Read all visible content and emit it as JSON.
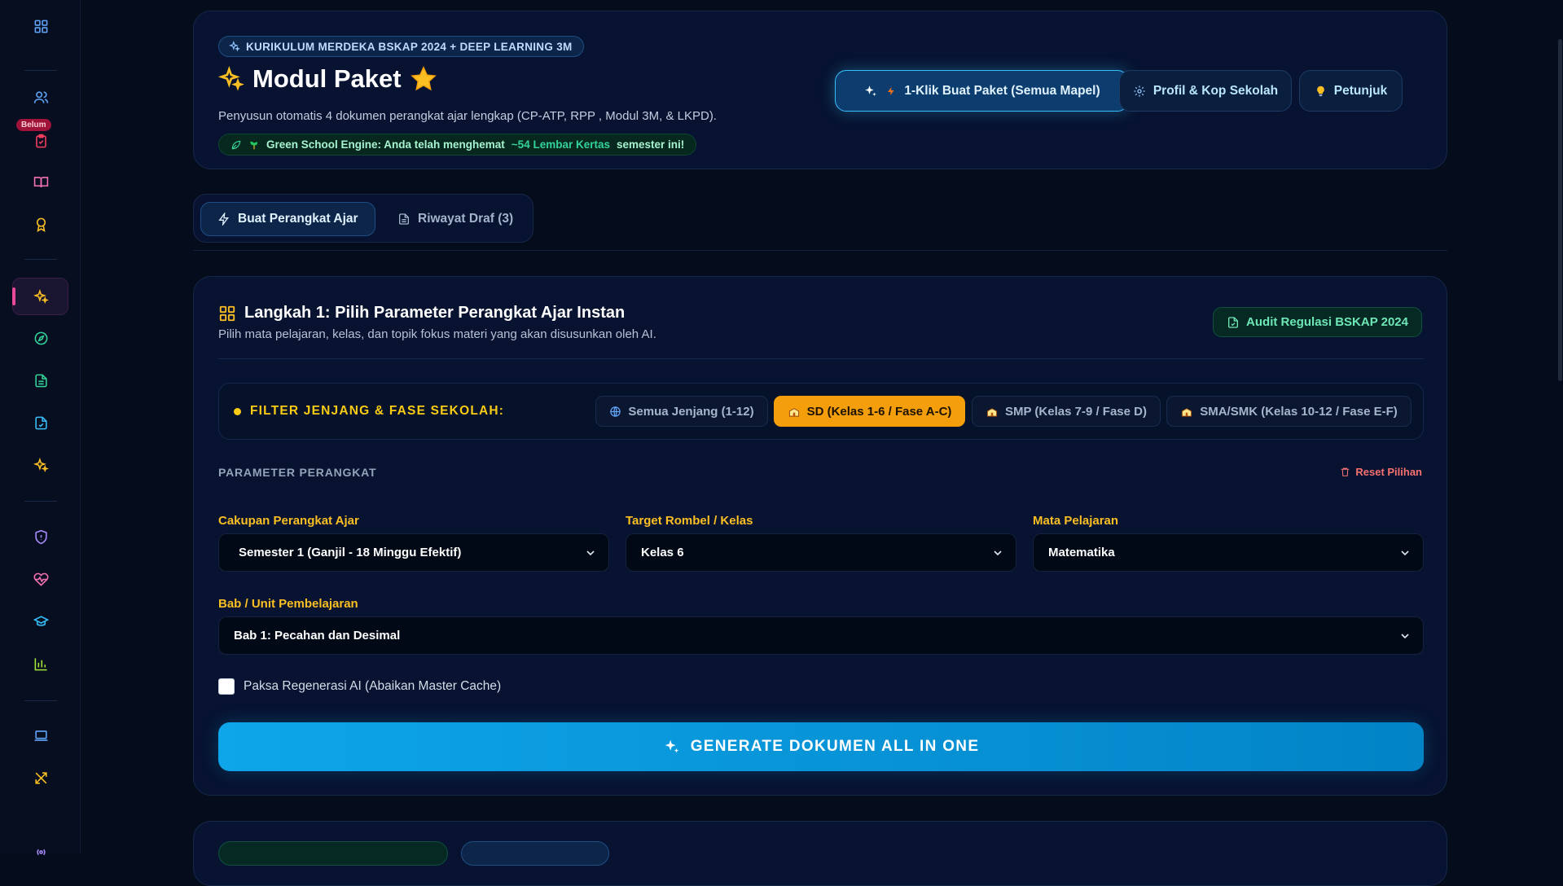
{
  "colors": {
    "background": "#050c1c",
    "card": "#071330",
    "accent_blue": "#38bdf8",
    "accent_amber": "#f59e0b",
    "accent_green": "#34d399",
    "accent_red": "#f87171",
    "label_amber": "#fbbf24"
  },
  "sidebar": {
    "items": [
      {
        "icon": "grid-icon"
      },
      {
        "icon": "users-icon"
      },
      {
        "icon": "clipboard-check-icon",
        "badge": "Belum"
      },
      {
        "icon": "book-open-icon"
      },
      {
        "icon": "award-icon"
      },
      {
        "icon": "sparkles-icon",
        "active": true
      },
      {
        "icon": "compass-icon"
      },
      {
        "icon": "file-text-icon"
      },
      {
        "icon": "file-check-icon"
      },
      {
        "icon": "sparkles-icon"
      },
      {
        "icon": "shield-icon"
      },
      {
        "icon": "heart-pulse-icon"
      },
      {
        "icon": "graduation-cap-icon"
      },
      {
        "icon": "bar-chart-icon"
      },
      {
        "icon": "laptop-icon"
      },
      {
        "icon": "tools-icon"
      },
      {
        "icon": "broadcast-icon"
      }
    ],
    "badge_label": "Belum"
  },
  "header": {
    "pill": "KURIKULUM MERDEKA BSKAP 2024 + DEEP LEARNING 3M",
    "title": "Modul Paket",
    "subtitle": "Penyusun otomatis 4 dokumen perangkat ajar lengkap (CP-ATP, RPP , Modul 3M, & LKPD).",
    "green_engine": {
      "prefix": "Green School Engine: Anda telah menghemat",
      "highlight": "~54 Lembar Kertas",
      "suffix": "semester ini!"
    },
    "buttons": {
      "primary": "1-Klik Buat Paket (Semua Mapel)",
      "profile": "Profil & Kop Sekolah",
      "guide": "Petunjuk"
    }
  },
  "tabs": [
    {
      "label": "Buat Perangkat Ajar",
      "active": true
    },
    {
      "label": "Riwayat Draf (3)",
      "active": false
    }
  ],
  "step": {
    "title": "Langkah 1: Pilih Parameter Perangkat Ajar Instan",
    "subtitle": "Pilih mata pelajaran, kelas, dan topik fokus materi yang akan disusunkan oleh AI.",
    "audit_button": "Audit Regulasi BSKAP 2024",
    "filter": {
      "label": "FILTER JENJANG & FASE SEKOLAH:",
      "options": [
        {
          "label": "Semua Jenjang (1-12)",
          "active": false
        },
        {
          "label": "SD (Kelas 1-6 / Fase A-C)",
          "active": true
        },
        {
          "label": "SMP (Kelas 7-9 / Fase D)",
          "active": false
        },
        {
          "label": "SMA/SMK (Kelas 10-12 / Fase E-F)",
          "active": false
        }
      ]
    },
    "params_heading": "PARAMETER PERANGKAT",
    "reset_label": "Reset Pilihan",
    "fields": {
      "cakupan": {
        "label": "Cakupan Perangkat Ajar",
        "value": "Semester 1 (Ganjil - 18 Minggu Efektif)"
      },
      "rombel": {
        "label": "Target Rombel / Kelas",
        "value": "Kelas 6"
      },
      "mapel": {
        "label": "Mata Pelajaran",
        "value": "Matematika"
      },
      "bab": {
        "label": "Bab / Unit Pembelajaran",
        "value": "Bab 1: Pecahan dan Desimal"
      }
    },
    "checkbox_label": "Paksa Regenerasi AI (Abaikan Master Cache)",
    "checkbox_checked": false,
    "generate_button": "GENERATE DOKUMEN ALL IN ONE"
  }
}
